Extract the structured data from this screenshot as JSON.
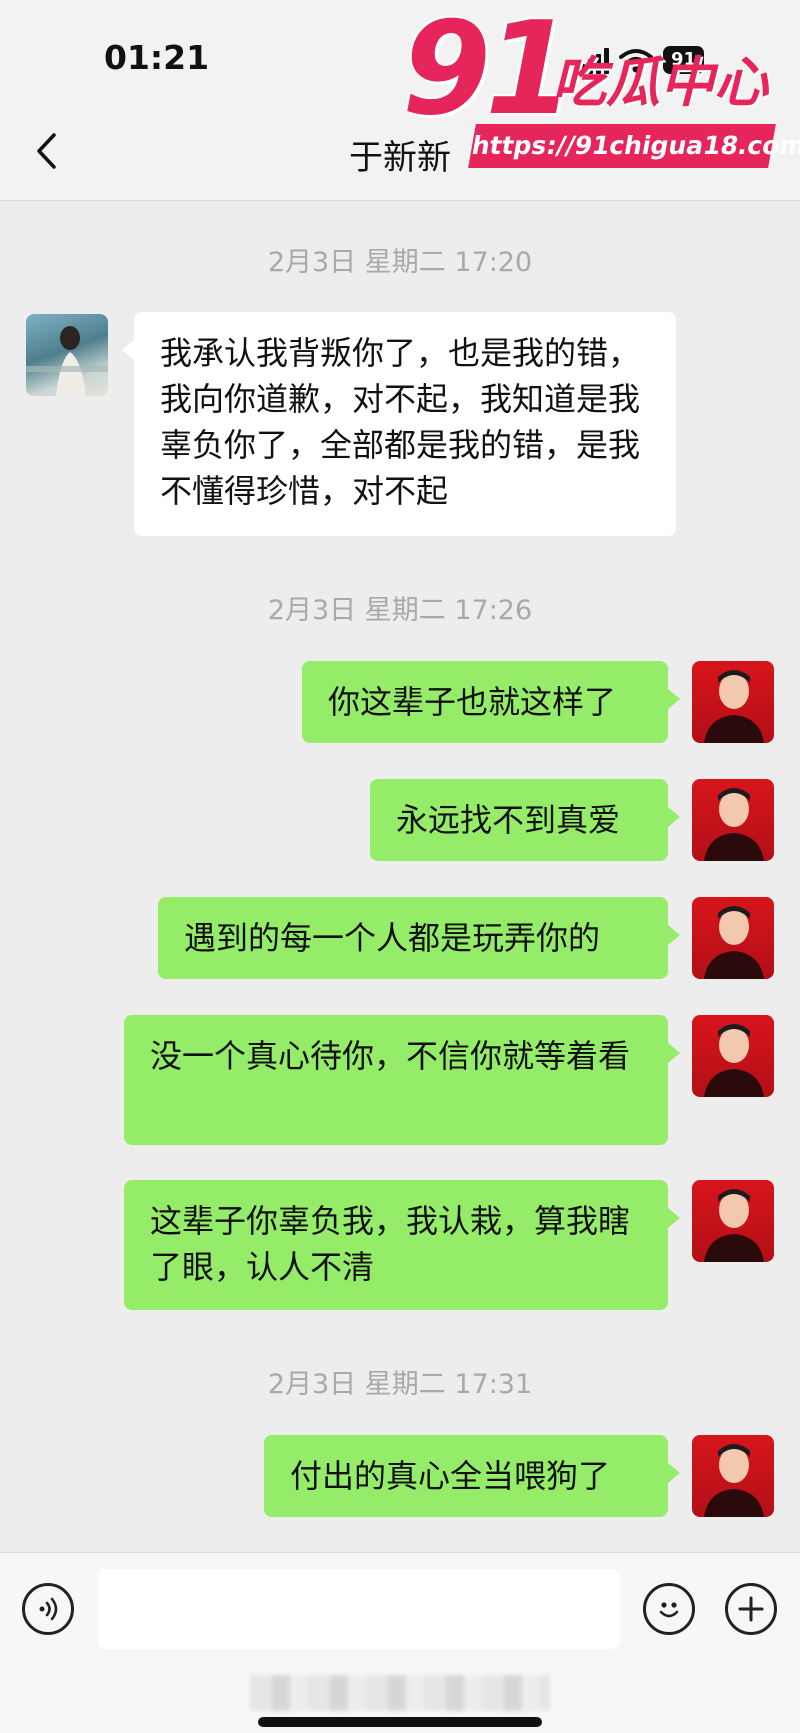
{
  "status_bar": {
    "time": "01:21",
    "battery": "91"
  },
  "header": {
    "contact_name": "于新新"
  },
  "watermark": {
    "number": "91",
    "text": "吃瓜中心",
    "url": "https://91chigua18.com"
  },
  "chat": {
    "timestamps": [
      "2月3日 星期二 17:20",
      "2月3日 星期二 17:26",
      "2月3日 星期二 17:31"
    ],
    "messages": [
      {
        "sender": "contact",
        "text": "我承认我背叛你了，也是我的错，我向你道歉，对不起，我知道是我辜负你了，全部都是我的错，是我不懂得珍惜，对不起"
      },
      {
        "sender": "me",
        "text": "你这辈子也就这样了"
      },
      {
        "sender": "me",
        "text": "永远找不到真爱"
      },
      {
        "sender": "me",
        "text": "遇到的每一个人都是玩弄你的"
      },
      {
        "sender": "me",
        "text": "没一个真心待你，不信你就等着看"
      },
      {
        "sender": "me",
        "text": "这辈子你辜负我，我认栽，算我瞎了眼，认人不清"
      },
      {
        "sender": "me",
        "text": "付出的真心全当喂狗了"
      }
    ]
  },
  "input_bar": {
    "message_value": "",
    "icons": [
      "voice-icon",
      "emoji-icon",
      "plus-icon"
    ]
  },
  "colors": {
    "sent_bubble": "#95ec69",
    "received_bubble": "#ffffff",
    "background": "#ededed",
    "watermark": "#e6265b"
  }
}
